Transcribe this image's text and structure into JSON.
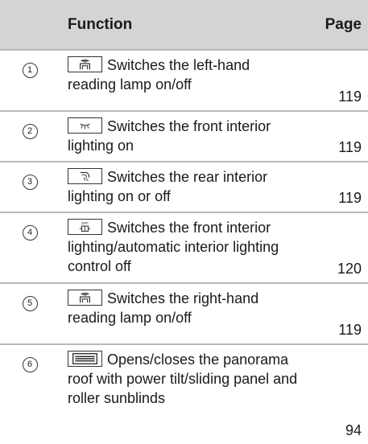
{
  "header": {
    "col_function": "Function",
    "col_page": "Page"
  },
  "rows": [
    {
      "number": "1",
      "icon": "reading-lamp-icon",
      "text": "Switches the left-hand reading lamp on/off",
      "page": "119"
    },
    {
      "number": "2",
      "icon": "front-interior-light-icon",
      "text": "Switches the front interior lighting on",
      "page": "119"
    },
    {
      "number": "3",
      "icon": "rear-interior-light-icon",
      "text": "Switches the rear interior lighting on or off",
      "page": "119"
    },
    {
      "number": "4",
      "icon": "interior-light-off-icon",
      "icon_label": "OFF",
      "text": "Switches the front interior lighting/automatic interior lighting control off",
      "page": "120"
    },
    {
      "number": "5",
      "icon": "reading-lamp-icon",
      "text": "Switches the right-hand reading lamp on/off",
      "page": "119"
    },
    {
      "number": "6",
      "icon": "roller-blind-icon",
      "text": "Opens/closes the panorama roof with power tilt/sliding panel and roller sunblinds",
      "page": "94"
    }
  ]
}
